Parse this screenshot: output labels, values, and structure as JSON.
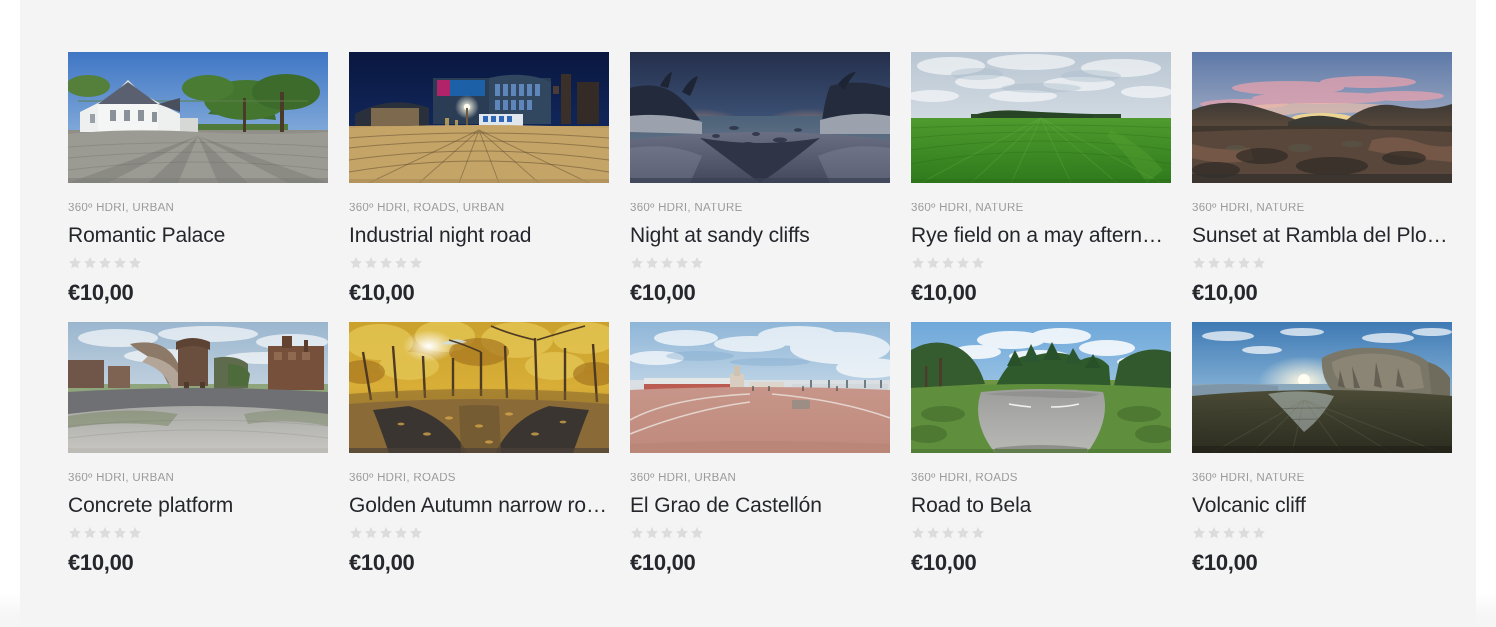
{
  "page": {
    "background_color": "#f4f4f4",
    "title_color": "#24262b",
    "meta_color": "#9a9a9a",
    "price_color": "#25272c",
    "star_color": "#dcdcdc"
  },
  "products": [
    {
      "categories": "360º HDRI, URBAN",
      "title": "Romantic Palace",
      "rating": 0,
      "stars_total": 5,
      "price": "€10,00",
      "thumbnail": "panorama-romantic-palace"
    },
    {
      "categories": "360º HDRI, ROADS, URBAN",
      "title": "Industrial night road",
      "rating": 0,
      "stars_total": 5,
      "price": "€10,00",
      "thumbnail": "panorama-industrial-night-road"
    },
    {
      "categories": "360º HDRI, NATURE",
      "title": "Night at sandy cliffs",
      "rating": 0,
      "stars_total": 5,
      "price": "€10,00",
      "thumbnail": "panorama-night-at-sandy-cliffs"
    },
    {
      "categories": "360º HDRI, NATURE",
      "title": "Rye field on a may afterno…",
      "rating": 0,
      "stars_total": 5,
      "price": "€10,00",
      "thumbnail": "panorama-rye-field"
    },
    {
      "categories": "360º HDRI, NATURE",
      "title": "Sunset at Rambla del Plo…",
      "rating": 0,
      "stars_total": 5,
      "price": "€10,00",
      "thumbnail": "panorama-sunset-rambla"
    },
    {
      "categories": "360º HDRI, URBAN",
      "title": "Concrete platform",
      "rating": 0,
      "stars_total": 5,
      "price": "€10,00",
      "thumbnail": "panorama-concrete-platform"
    },
    {
      "categories": "360º HDRI, ROADS",
      "title": "Golden Autumn narrow ro…",
      "rating": 0,
      "stars_total": 5,
      "price": "€10,00",
      "thumbnail": "panorama-golden-autumn-road"
    },
    {
      "categories": "360º HDRI, URBAN",
      "title": "El Grao de Castellón",
      "rating": 0,
      "stars_total": 5,
      "price": "€10,00",
      "thumbnail": "panorama-el-grao-de-castellon"
    },
    {
      "categories": "360º HDRI, ROADS",
      "title": "Road to Bela",
      "rating": 0,
      "stars_total": 5,
      "price": "€10,00",
      "thumbnail": "panorama-road-to-bela"
    },
    {
      "categories": "360º HDRI, NATURE",
      "title": "Volcanic cliff",
      "rating": 0,
      "stars_total": 5,
      "price": "€10,00",
      "thumbnail": "panorama-volcanic-cliff"
    }
  ]
}
